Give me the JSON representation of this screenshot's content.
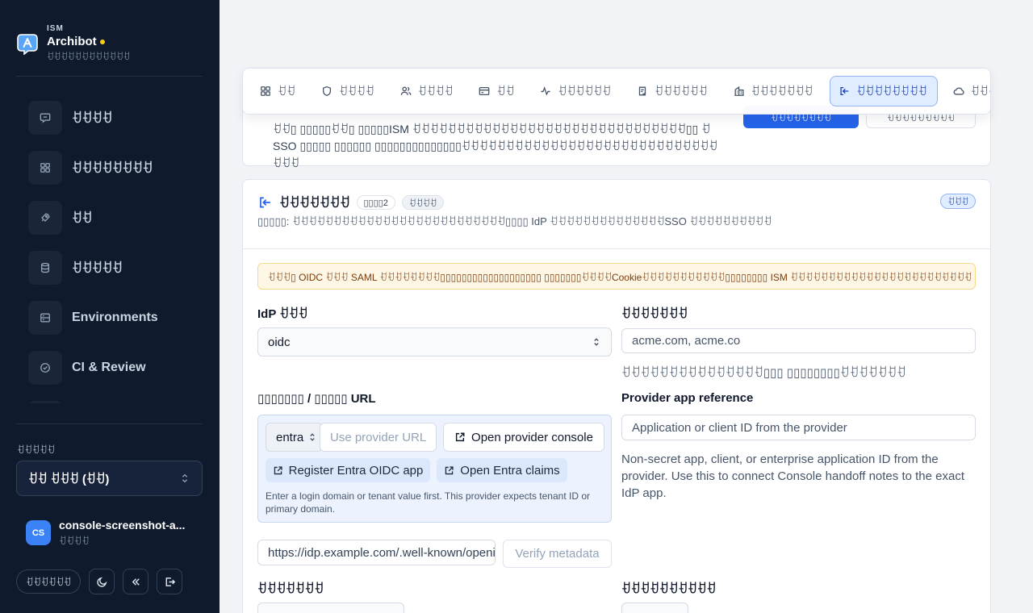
{
  "brand": {
    "kicker": "ISM",
    "name": "Archibot",
    "subtitle": "ꀀꀀꀀꀀꀀꀀꀀꀀꀀꀀꀀꀀ",
    "logo_icon": "chat-a-logo-icon",
    "accent": "#facc15"
  },
  "sidebar": {
    "items": [
      {
        "label": "ꀀꀀꀀꀀ",
        "icon": "chat-icon"
      },
      {
        "label": "ꀀꀀꀀꀀꀀꀀꀀꀀ",
        "icon": "grid-icon"
      },
      {
        "label": "ꀀꀀ",
        "icon": "rocket-icon"
      },
      {
        "label": "ꀀꀀꀀꀀꀀ",
        "icon": "database-icon"
      },
      {
        "label": "Environments",
        "icon": "server-icon"
      },
      {
        "label": "CI & Review",
        "icon": "check-circle-icon"
      }
    ],
    "workspace_label": "ꀀꀀꀀꀀꀀ",
    "workspace_value": "ꀀꀀ  ꀀꀀꀀ (ꀀꀀ)",
    "user": {
      "initials": "CS",
      "name": "console-screenshot-a...",
      "role": "ꀀꀀꀀꀀ"
    },
    "lang_button": "ꀀꀀꀀꀀꀀꀀ"
  },
  "tabs": [
    {
      "label": "ꀀꀀ",
      "icon": "grid-icon"
    },
    {
      "label": "ꀀꀀꀀꀀ",
      "icon": "shield-icon"
    },
    {
      "label": "ꀀꀀꀀꀀ",
      "icon": "users-icon"
    },
    {
      "label": "ꀀꀀ",
      "icon": "card-icon"
    },
    {
      "label": "ꀀꀀꀀꀀꀀꀀ",
      "icon": "activity-icon"
    },
    {
      "label": "ꀀꀀꀀꀀꀀꀀ",
      "icon": "clipboard-check-icon"
    },
    {
      "label": "ꀀꀀꀀꀀꀀꀀꀀ",
      "icon": "building-icon"
    },
    {
      "label": "ꀀꀀꀀꀀꀀꀀꀀꀀ",
      "icon": "sign-in-icon",
      "active": true
    },
    {
      "label": "ꀀꀀꀀꀀꀀꀀꀀꀀꀀ",
      "icon": "cloud-icon"
    }
  ],
  "top_card": {
    "text": "ꀀꀀ▯ ▯▯▯▯▯ꀀꀀ▯ ▯▯▯▯▯ISM ꀀꀀꀀꀀꀀꀀꀀꀀꀀꀀꀀꀀꀀꀀꀀꀀꀀꀀꀀꀀꀀꀀꀀꀀꀀꀀꀀꀀꀀꀀꀀ▯▯ ꀀ SSO ▯▯▯▯▯ ▯▯▯▯▯▯ ▯▯▯▯▯▯▯▯▯▯▯▯▯▯ꀀꀀꀀꀀꀀꀀꀀꀀꀀꀀꀀꀀꀀꀀꀀꀀꀀꀀꀀꀀꀀꀀꀀꀀꀀꀀꀀꀀꀀꀀꀀꀀ",
    "primary_button": "ꀀꀀꀀꀀꀀꀀꀀꀀ",
    "secondary_button": "ꀀꀀꀀꀀꀀꀀꀀꀀꀀ"
  },
  "section": {
    "title": "ꀀꀀꀀꀀꀀꀀꀀ",
    "step_pill": "▯▯▯▯2",
    "status_pill": "ꀀꀀꀀꀀ",
    "badge": "ꀀꀀꀀ",
    "description": "▯▯▯▯▯: ꀀꀀꀀꀀꀀꀀꀀꀀꀀꀀꀀꀀꀀꀀꀀꀀꀀꀀꀀꀀꀀꀀꀀꀀꀀꀀ▯▯▯▯ IdP ꀀꀀꀀꀀꀀꀀꀀꀀꀀꀀꀀꀀꀀꀀSSO ꀀꀀꀀꀀꀀꀀꀀꀀꀀꀀ",
    "warning": "ꀀꀀꀀ▯ OIDC ꀀꀀꀀ SAML ꀀꀀꀀꀀꀀꀀꀀꀀ▯▯▯▯▯▯▯▯▯▯▯▯▯▯▯▯▯▯▯ ▯▯▯▯▯▯▯ꀀꀀꀀꀀCookieꀀꀀꀀꀀꀀꀀꀀꀀꀀꀀꀀ▯▯▯▯▯▯▯▯ ISM ꀀꀀꀀꀀꀀꀀꀀꀀꀀꀀꀀꀀꀀꀀꀀꀀꀀꀀꀀꀀꀀꀀꀀꀀ"
  },
  "form": {
    "idp_type_label": "IdP ꀀꀀꀀ",
    "idp_type_value": "oidc",
    "domains_label": "ꀀꀀꀀꀀꀀꀀꀀ",
    "domains_placeholder": "acme.com, acme.co",
    "domains_help": "ꀀꀀꀀꀀꀀꀀꀀꀀꀀꀀꀀꀀꀀꀀꀀ▯▯▯ ▯▯▯▯▯▯▯▯ꀀꀀꀀꀀꀀꀀꀀ",
    "provider_label": "▯▯▯▯▯▯▯ / ▯▯▯▯▯ URL",
    "provider_select_value": "entra",
    "provider_url_placeholder": "Use provider URL",
    "open_console_button": "Open provider console",
    "register_button": "Register Entra OIDC app",
    "claims_button": "Open Entra claims",
    "provider_note": "Enter a login domain or tenant value first. This provider expects tenant ID or primary domain.",
    "app_ref_label": "Provider app reference",
    "app_ref_placeholder": "Application or client ID from the provider",
    "app_ref_help": "Non-secret app, client, or enterprise application ID from the provider. Use this to connect Console handoff notes to the exact IdP app.",
    "metadata_value": "https://idp.example.com/.well-known/openid-configuration",
    "verify_button": "Verify metadata",
    "lower_left_label": "ꀀꀀꀀꀀꀀꀀꀀ",
    "lower_right_label": "ꀀꀀꀀꀀꀀꀀꀀꀀꀀꀀ"
  }
}
